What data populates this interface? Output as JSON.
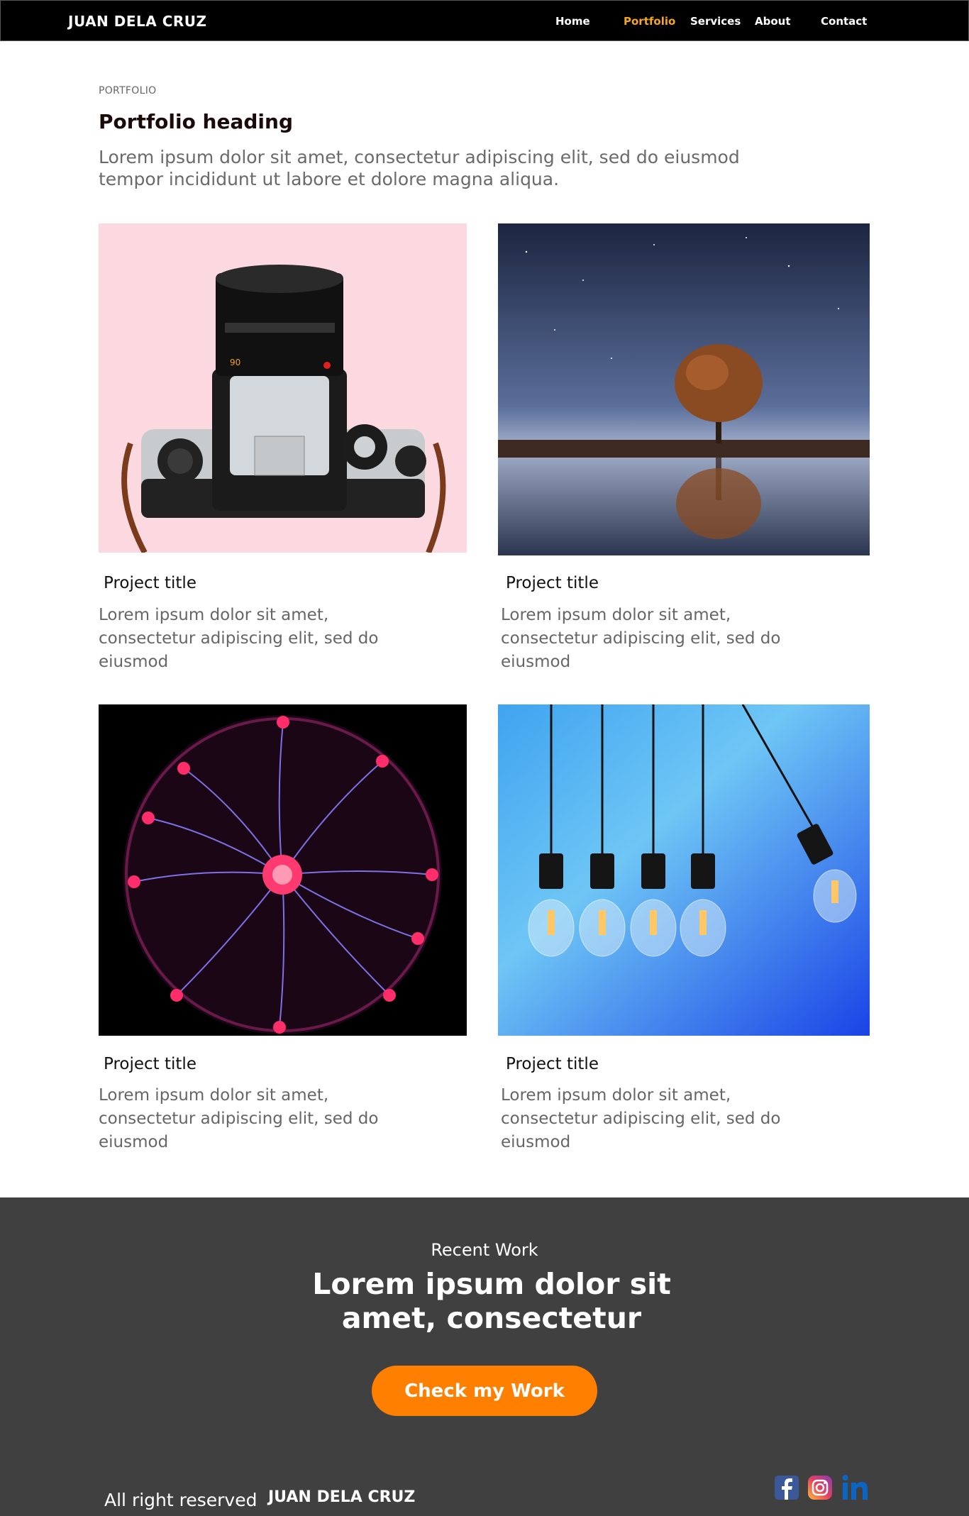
{
  "nav": {
    "brand": "JUAN DELA CRUZ",
    "items": [
      {
        "label": "Home",
        "active": false
      },
      {
        "label": "Portfolio",
        "active": true
      },
      {
        "label": "Services",
        "active": false
      },
      {
        "label": "About",
        "active": false
      },
      {
        "label": "Contact",
        "active": false
      }
    ]
  },
  "header": {
    "eyebrow": "PORTFOLIO",
    "heading": "Portfolio heading",
    "lead": "Lorem ipsum dolor sit amet, consectetur adipiscing elit, sed do eiusmod tempor incididunt ut labore et dolore magna aliqua."
  },
  "projects": [
    {
      "title": "Project title",
      "description": "Lorem ipsum dolor sit amet, consectetur adipiscing elit, sed do eiusmod",
      "image": "camera-photo"
    },
    {
      "title": "Project title",
      "description": "Lorem ipsum dolor sit amet, consectetur adipiscing elit, sed do eiusmod",
      "image": "tree-reflection-photo"
    },
    {
      "title": "Project title",
      "description": "Lorem ipsum dolor sit amet, consectetur adipiscing elit, sed do eiusmod",
      "image": "plasma-ball-photo"
    },
    {
      "title": "Project title",
      "description": "Lorem ipsum dolor sit amet, consectetur adipiscing elit, sed do eiusmod",
      "image": "light-bulbs-photo"
    }
  ],
  "footer": {
    "eyebrow": "Recent Work",
    "headline": "Lorem ipsum dolor sit amet, consectetur",
    "cta_label": "Check my Work",
    "rights": "All right reserved",
    "brand": "JUAN DELA CRUZ",
    "social": [
      "facebook-icon",
      "instagram-icon",
      "linkedin-icon"
    ]
  },
  "colors": {
    "nav_bg": "#000000",
    "nav_active": "#f5a623",
    "footer_bg": "#414040",
    "cta": "#ff7f00"
  }
}
